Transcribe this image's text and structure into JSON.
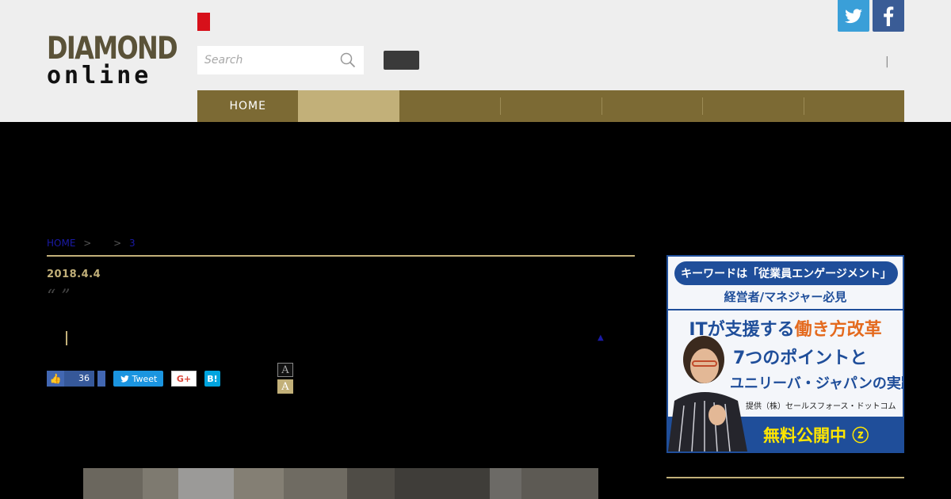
{
  "header": {
    "logo_top": "DIAMOND",
    "logo_bottom": "online",
    "search_placeholder": "Search",
    "separator": "|"
  },
  "nav": {
    "items": [
      {
        "label": "HOME",
        "active": false
      },
      {
        "label": "",
        "active": true
      },
      {
        "label": "",
        "active": false
      },
      {
        "label": "",
        "active": false
      },
      {
        "label": "",
        "active": false
      },
      {
        "label": "",
        "active": false
      },
      {
        "label": "",
        "active": false
      }
    ]
  },
  "breadcrumb": {
    "home": "HOME",
    "sep1": ">",
    "sep2": ">",
    "last": "3"
  },
  "article": {
    "date": "2018.4.4",
    "quote": "“ ”",
    "triangle": "▲"
  },
  "share": {
    "like_count": "36",
    "tweet_label": "Tweet",
    "gplus_label": "G+",
    "hatena_label": "B!",
    "font_small": "A",
    "font_large": "A"
  },
  "ad": {
    "pill": "キーワードは「従業員エンゲージメント」",
    "sub": "経営者/マネジャー必見",
    "line1_a": "ITが支援する",
    "line1_b": "働き方改革",
    "line2": "7つのポイントと",
    "line3": "ユニリーバ・ジャパンの実践",
    "credit": "提供（株）セールスフォース・ドットコム",
    "cta": "無料公開中 ⓩ"
  },
  "colors": {
    "header_bg": "#eeeeee",
    "nav_bg": "#7c6a34",
    "nav_active": "#c2b079",
    "accent_gold": "#c2b079",
    "twitter": "#3a9fd8",
    "facebook": "#3a5c96"
  }
}
